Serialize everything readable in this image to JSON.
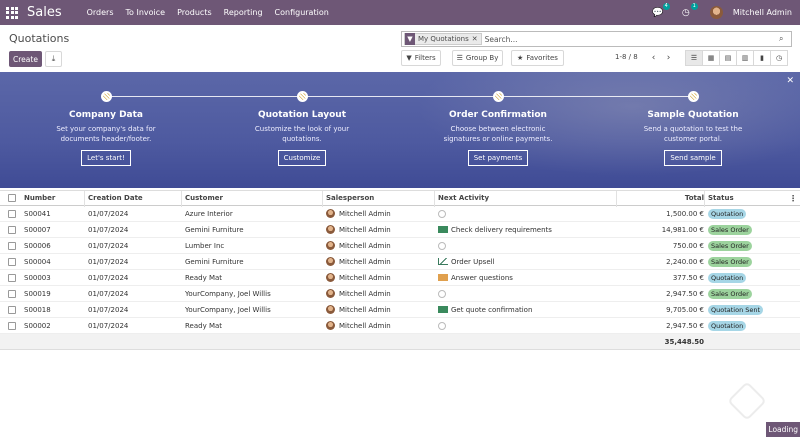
{
  "navbar": {
    "brand": "Sales",
    "menu": [
      "Orders",
      "To Invoice",
      "Products",
      "Reporting",
      "Configuration"
    ],
    "messages_count": "4",
    "activities_count": "1",
    "user_name": "Mitchell Admin"
  },
  "control_panel": {
    "breadcrumb": "Quotations",
    "create_label": "Create",
    "facet_label": "My Quotations",
    "search_placeholder": "Search...",
    "filters_label": "Filters",
    "groupby_label": "Group By",
    "favorites_label": "Favorites",
    "pager": "1-8 / 8"
  },
  "banner": {
    "steps": [
      {
        "title": "Company Data",
        "desc": "Set your company's data for documents header/footer.",
        "button": "Let's start!"
      },
      {
        "title": "Quotation Layout",
        "desc": "Customize the look of your quotations.",
        "button": "Customize"
      },
      {
        "title": "Order Confirmation",
        "desc": "Choose between electronic signatures or online payments.",
        "button": "Set payments"
      },
      {
        "title": "Sample Quotation",
        "desc": "Send a quotation to test the customer portal.",
        "button": "Send sample"
      }
    ]
  },
  "table": {
    "headers": {
      "number": "Number",
      "date": "Creation Date",
      "customer": "Customer",
      "salesperson": "Salesperson",
      "activity": "Next Activity",
      "total": "Total",
      "status": "Status"
    },
    "rows": [
      {
        "number": "S00041",
        "date": "01/07/2024",
        "customer": "Azure Interior",
        "salesperson": "Mitchell Admin",
        "activity": "",
        "activity_icon": "clock-icon",
        "total": "1,500.00 €",
        "status": "Quotation",
        "status_type": "quotation"
      },
      {
        "number": "S00007",
        "date": "01/07/2024",
        "customer": "Gemini Furniture",
        "salesperson": "Mitchell Admin",
        "activity": "Check delivery requirements",
        "activity_icon": "todo-icon",
        "total": "14,981.00 €",
        "status": "Sales Order",
        "status_type": "order"
      },
      {
        "number": "S00006",
        "date": "01/07/2024",
        "customer": "Lumber Inc",
        "salesperson": "Mitchell Admin",
        "activity": "",
        "activity_icon": "clock-icon",
        "total": "750.00 €",
        "status": "Sales Order",
        "status_type": "order"
      },
      {
        "number": "S00004",
        "date": "01/07/2024",
        "customer": "Gemini Furniture",
        "salesperson": "Mitchell Admin",
        "activity": "Order Upsell",
        "activity_icon": "upsell-icon",
        "total": "2,240.00 €",
        "status": "Sales Order",
        "status_type": "order"
      },
      {
        "number": "S00003",
        "date": "01/07/2024",
        "customer": "Ready Mat",
        "salesperson": "Mitchell Admin",
        "activity": "Answer questions",
        "activity_icon": "mail-icon",
        "total": "377.50 €",
        "status": "Quotation",
        "status_type": "quotation"
      },
      {
        "number": "S00019",
        "date": "01/07/2024",
        "customer": "YourCompany, Joel Willis",
        "salesperson": "Mitchell Admin",
        "activity": "",
        "activity_icon": "clock-icon",
        "total": "2,947.50 €",
        "status": "Sales Order",
        "status_type": "order"
      },
      {
        "number": "S00018",
        "date": "01/07/2024",
        "customer": "YourCompany, Joel Willis",
        "salesperson": "Mitchell Admin",
        "activity": "Get quote confirmation",
        "activity_icon": "todo-icon",
        "total": "9,705.00 €",
        "status": "Quotation Sent",
        "status_type": "sent"
      },
      {
        "number": "S00002",
        "date": "01/07/2024",
        "customer": "Ready Mat",
        "salesperson": "Mitchell Admin",
        "activity": "",
        "activity_icon": "clock-icon",
        "total": "2,947.50 €",
        "status": "Quotation",
        "status_type": "quotation"
      }
    ],
    "grand_total": "35,448.50"
  },
  "status_bar": {
    "loading": "Loading"
  }
}
